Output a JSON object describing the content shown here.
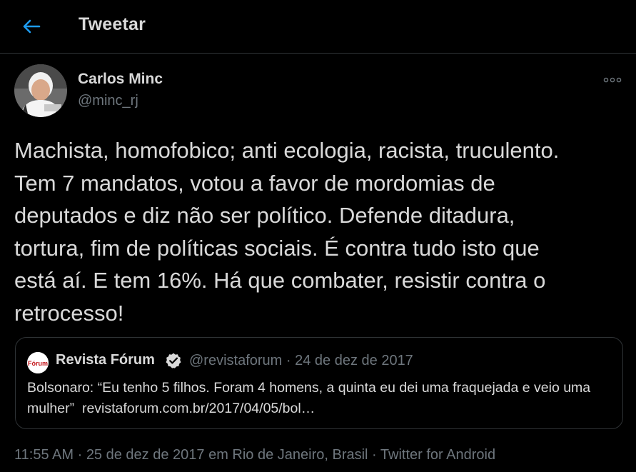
{
  "header": {
    "back_icon": "arrow-left-icon",
    "title": "Tweetar",
    "accent_color": "#1d9bf0"
  },
  "tweet": {
    "author": {
      "display_name": "Carlos Minc",
      "handle": "@minc_rj"
    },
    "more_icon": "more-horizontal-icon",
    "text": "Machista, homofobico; anti ecologia, racista, truculento.\nTem 7 mandatos, votou a favor de mordomias de\ndeputados e diz não ser político. Defende ditadura,\ntortura, fim de políticas sociais. É contra tudo isto que\nestá aí. E tem 16%. Há que combater, resistir contra o\nretrocesso!",
    "quoted": {
      "logo_text": "Fórum",
      "name": "Revista Fórum",
      "verified_icon": "verified-badge-icon",
      "meta": "@revistaforum · 24 de dez de 2017",
      "text": "Bolsonaro: “Eu tenho 5 filhos. Foram 4 homens, a quinta eu dei uma fraquejada e veio uma mulher”",
      "link": "revistaforum.com.br/2017/04/05/bol…"
    },
    "footer": {
      "time": "11:55 AM",
      "separator": " · ",
      "date_location": "25 de dez de 2017 em Rio de Janeiro, Brasil",
      "source": "Twitter for Android"
    }
  }
}
